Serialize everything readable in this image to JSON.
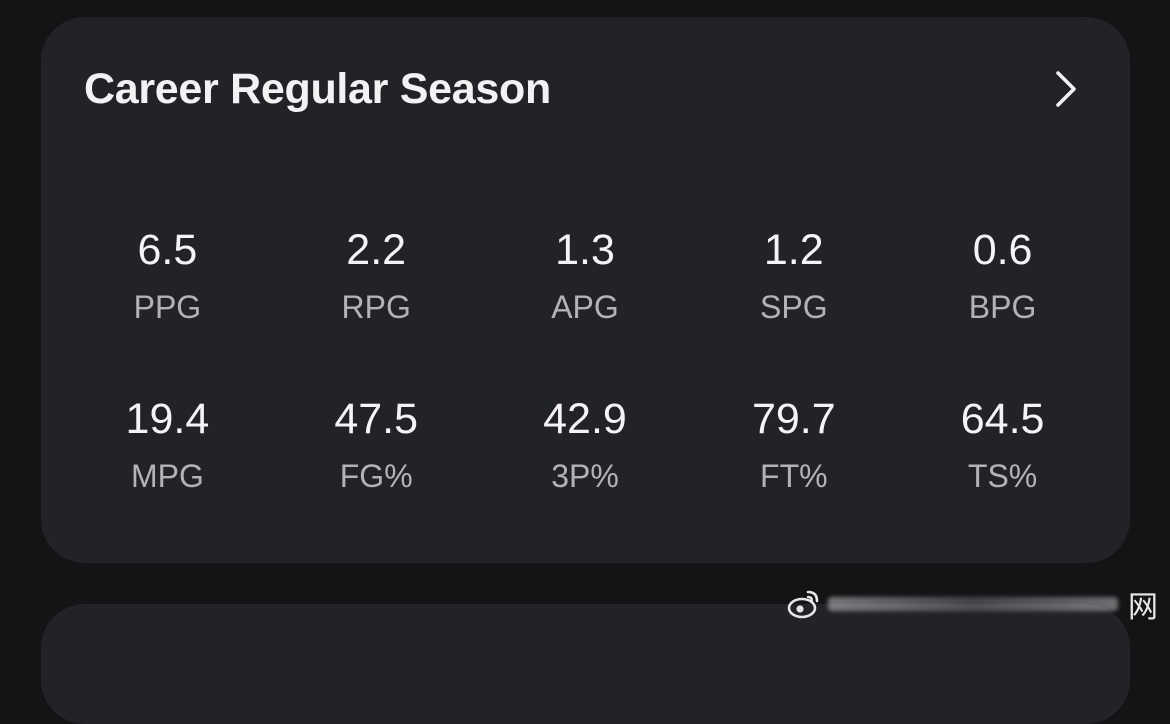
{
  "card": {
    "title": "Career Regular Season",
    "chevron_icon": "chevron-right-icon"
  },
  "stats": {
    "row1": [
      {
        "value": "6.5",
        "label": "PPG"
      },
      {
        "value": "2.2",
        "label": "RPG"
      },
      {
        "value": "1.3",
        "label": "APG"
      },
      {
        "value": "1.2",
        "label": "SPG"
      },
      {
        "value": "0.6",
        "label": "BPG"
      }
    ],
    "row2": [
      {
        "value": "19.4",
        "label": "MPG"
      },
      {
        "value": "47.5",
        "label": "FG%"
      },
      {
        "value": "42.9",
        "label": "3P%"
      },
      {
        "value": "79.7",
        "label": "FT%"
      },
      {
        "value": "64.5",
        "label": "TS%"
      }
    ]
  },
  "watermark": {
    "logo_icon": "weibo-logo-icon",
    "char": "网"
  },
  "colors": {
    "background": "#141416",
    "card": "#222327",
    "value_text": "#f4f4f6",
    "label_text": "#b2b3b8"
  }
}
